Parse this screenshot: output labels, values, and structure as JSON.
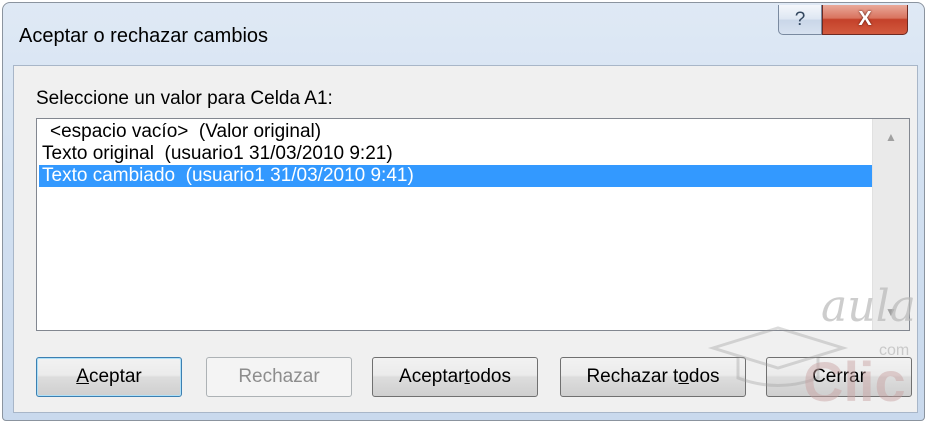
{
  "window": {
    "title": "Aceptar o rechazar cambios",
    "help_glyph": "?",
    "close_glyph": "X"
  },
  "dialog": {
    "prompt": "Seleccione un valor para Celda A1:",
    "list_items": [
      "<espacio vacío>  (Valor original)",
      "Texto original  (usuario1 31/03/2010 9:21)",
      "Texto cambiado  (usuario1 31/03/2010 9:41)"
    ],
    "selected_index": 2,
    "scroll_up_glyph": "▲",
    "scroll_down_glyph": "▼"
  },
  "buttons": {
    "accept": {
      "pre": "",
      "mnemonic": "A",
      "post": "ceptar"
    },
    "reject": {
      "label": "Rechazar"
    },
    "accept_all": {
      "pre": "Aceptar ",
      "mnemonic": "t",
      "post": "odos"
    },
    "reject_all": {
      "pre": "Rechazar t",
      "mnemonic": "o",
      "post": "dos"
    },
    "close": {
      "label": "Cerrar"
    }
  },
  "watermark": {
    "word1": "aula",
    "word2": "com",
    "word3": "Clic"
  },
  "colors": {
    "selection": "#3399ff",
    "close_button": "#c4412a"
  }
}
